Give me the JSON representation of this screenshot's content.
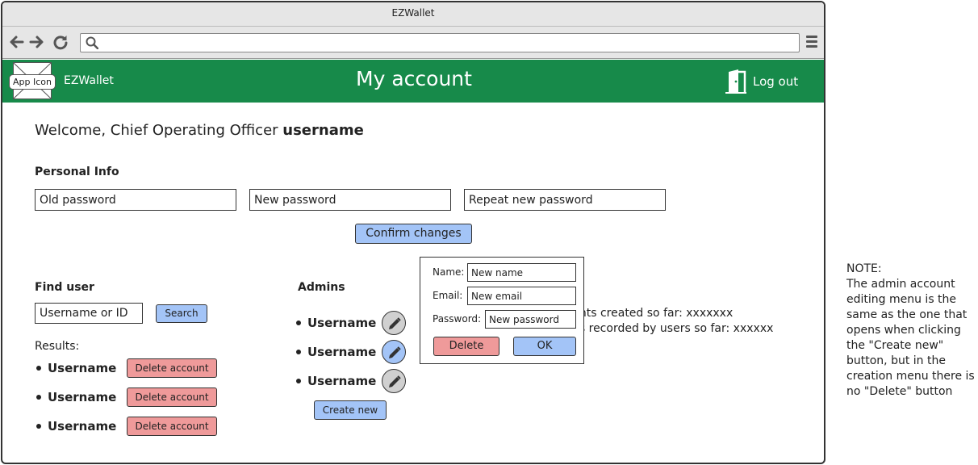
{
  "browser": {
    "title": "EZWallet",
    "url": ""
  },
  "header": {
    "app_icon_label": "App Icon",
    "app_name": "EZWallet",
    "page_title": "My account",
    "logout_label": "Log out"
  },
  "welcome": {
    "prefix": "Welcome, Chief Operating Officer",
    "username": "username"
  },
  "personal_info": {
    "label": "Personal Info",
    "old_password_placeholder": "Old password",
    "new_password_placeholder": "New password",
    "repeat_password_placeholder": "Repeat new password",
    "confirm_label": "Confirm changes"
  },
  "find_user": {
    "label": "Find user",
    "search_placeholder": "Username or ID",
    "search_button": "Search",
    "results_label": "Results:",
    "results": [
      {
        "name": "Username",
        "action": "Delete account"
      },
      {
        "name": "Username",
        "action": "Delete account"
      },
      {
        "name": "Username",
        "action": "Delete account"
      }
    ]
  },
  "admins": {
    "label": "Admins",
    "items": [
      {
        "name": "Username"
      },
      {
        "name": "Username"
      },
      {
        "name": "Username"
      }
    ],
    "create_button": "Create new"
  },
  "stats": {
    "line1": "unts created so far: xxxxxxx",
    "line2": "ns recorded by users so far: xxxxxx"
  },
  "edit_popup": {
    "name_label": "Name:",
    "name_placeholder": "New name",
    "email_label": "Email:",
    "email_placeholder": "New email",
    "password_label": "Password:",
    "password_placeholder": "New password",
    "delete_button": "Delete",
    "ok_button": "OK"
  },
  "note": "NOTE:\nThe admin account editing menu is the same as the one that opens when clicking the \"Create new\" button, but in the creation menu there is no \"Delete\" button",
  "colors": {
    "header_green": "#178a4a",
    "button_blue": "#a3c4f7",
    "button_red": "#ef9a9a"
  }
}
